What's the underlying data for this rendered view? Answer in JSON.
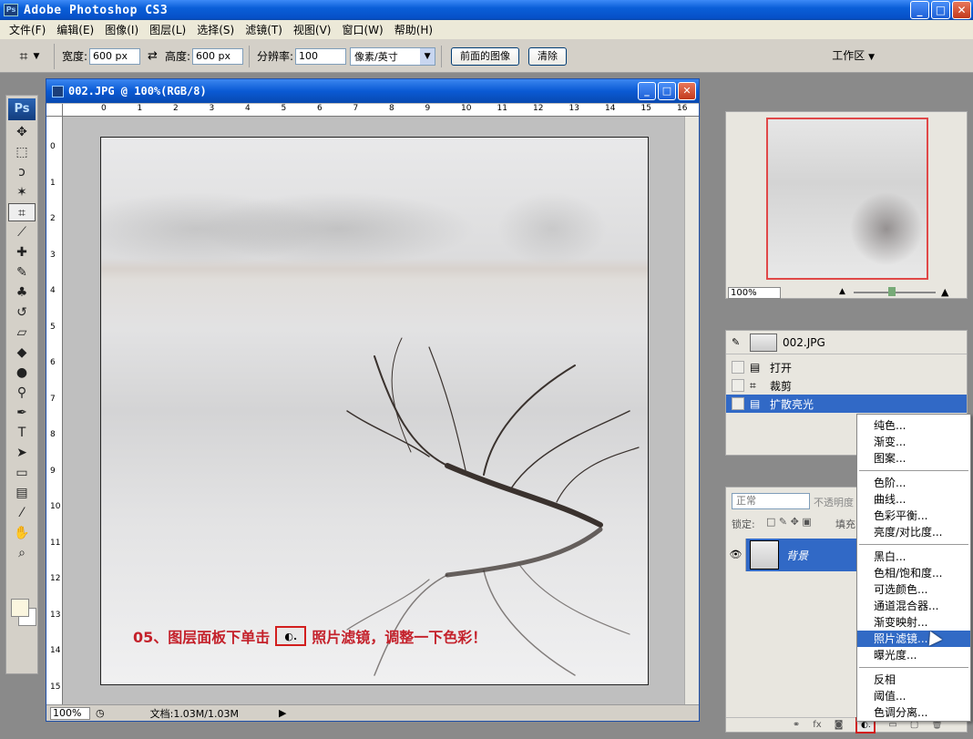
{
  "app": {
    "title": "Adobe Photoshop CS3",
    "logo": "Ps"
  },
  "menu": [
    "文件(F)",
    "编辑(E)",
    "图像(I)",
    "图层(L)",
    "选择(S)",
    "滤镜(T)",
    "视图(V)",
    "窗口(W)",
    "帮助(H)"
  ],
  "options": {
    "width_label": "宽度:",
    "width_value": "600 px",
    "height_label": "高度:",
    "height_value": "600 px",
    "res_label": "分辨率:",
    "res_value": "100",
    "unit": "像素/英寸",
    "front_image_btn": "前面的图像",
    "clear_btn": "清除",
    "workspace": "工作区"
  },
  "document": {
    "title": "002.JPG @ 100%(RGB/8)",
    "ruler_h": [
      "0",
      "1",
      "2",
      "3",
      "4",
      "5",
      "6",
      "7",
      "8",
      "9",
      "10",
      "11",
      "12",
      "13",
      "14",
      "15",
      "16"
    ],
    "ruler_v": [
      "0",
      "1",
      "2",
      "3",
      "4",
      "5",
      "6",
      "7",
      "8",
      "9",
      "10",
      "11",
      "12",
      "13",
      "14",
      "15"
    ],
    "zoom": "100%",
    "doc_size": "文档:1.03M/1.03M"
  },
  "caption": {
    "before": "05、图层面板下单击",
    "after": "照片滤镜，调整一下色彩！"
  },
  "navigator": {
    "zoom": "100%"
  },
  "history": {
    "snapshot": "002.JPG",
    "items": [
      {
        "label": "打开",
        "icon": "doc-icon"
      },
      {
        "label": "裁剪",
        "icon": "crop-icon"
      },
      {
        "label": "扩散亮光",
        "icon": "doc-icon",
        "selected": true
      }
    ]
  },
  "layers": {
    "blend_mode": "正常",
    "opacity_label": "不透明度",
    "lock_label": "锁定:",
    "fill_label": "填充",
    "layer_name": "背景"
  },
  "popup_menu": {
    "groups": [
      [
        "纯色...",
        "渐变...",
        "图案..."
      ],
      [
        "色阶...",
        "曲线...",
        "色彩平衡...",
        "亮度/对比度..."
      ],
      [
        "黑白...",
        "色相/饱和度...",
        "可选颜色...",
        "通道混合器...",
        "渐变映射...",
        "照片滤镜...",
        "曝光度..."
      ],
      [
        "反相",
        "阈值...",
        "色调分离..."
      ]
    ],
    "highlighted": "照片滤镜..."
  }
}
